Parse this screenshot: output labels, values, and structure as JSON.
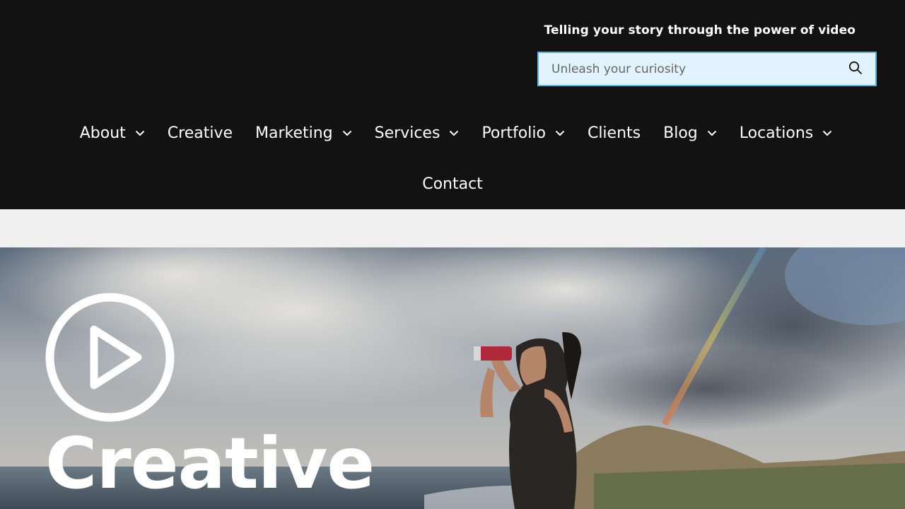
{
  "header": {
    "tagline": "Telling your story through the power of video",
    "search": {
      "placeholder": "Unleash your curiosity",
      "value": "",
      "icon": "search-icon"
    }
  },
  "nav": {
    "row1": [
      {
        "label": "About",
        "has_dropdown": true
      },
      {
        "label": "Creative",
        "has_dropdown": false
      },
      {
        "label": "Marketing",
        "has_dropdown": true
      },
      {
        "label": "Services",
        "has_dropdown": true
      },
      {
        "label": "Portfolio",
        "has_dropdown": true
      },
      {
        "label": "Clients",
        "has_dropdown": false
      },
      {
        "label": "Blog",
        "has_dropdown": true
      },
      {
        "label": "Locations",
        "has_dropdown": true
      }
    ],
    "row2": [
      {
        "label": "Contact",
        "has_dropdown": false
      }
    ]
  },
  "hero": {
    "title": "Creative",
    "icon": "play-icon"
  },
  "colors": {
    "header_bg": "#121212",
    "search_bg": "#e3f3fd",
    "search_border": "#5db4e4",
    "text_light": "#ffffff",
    "page_bg": "#f0f0f0"
  }
}
